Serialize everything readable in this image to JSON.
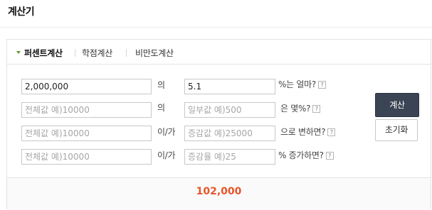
{
  "page": {
    "title": "계산기"
  },
  "tabs": [
    {
      "label": "퍼센트계산",
      "active": true
    },
    {
      "label": "학점계산",
      "active": false
    },
    {
      "label": "비만도계산",
      "active": false
    }
  ],
  "rows": [
    {
      "input1": {
        "value": "2,000,000",
        "placeholder": ""
      },
      "connector": "의",
      "input2": {
        "value": "5.1",
        "placeholder": ""
      },
      "suffix": "%는 얼마?"
    },
    {
      "input1": {
        "value": "",
        "placeholder": "전체값 예)10000"
      },
      "connector": "의",
      "input2": {
        "value": "",
        "placeholder": "일부값 예)500"
      },
      "suffix": "은 몇%?"
    },
    {
      "input1": {
        "value": "",
        "placeholder": "전체값 예)10000"
      },
      "connector": "이/가",
      "input2": {
        "value": "",
        "placeholder": "증감값 예)25000"
      },
      "suffix": "으로 변하면?"
    },
    {
      "input1": {
        "value": "",
        "placeholder": "전체값 예)10000"
      },
      "connector": "이/가",
      "input2": {
        "value": "",
        "placeholder": "증감율 예)25"
      },
      "suffix": "% 증가하면?"
    }
  ],
  "help_glyph": "?",
  "buttons": {
    "calculate": "계산",
    "reset": "초기화"
  },
  "result": {
    "value": "102,000"
  },
  "colors": {
    "accent_result": "#e8542a",
    "tab_arrow": "#5a9a2e",
    "calc_button": "#3b4454"
  }
}
